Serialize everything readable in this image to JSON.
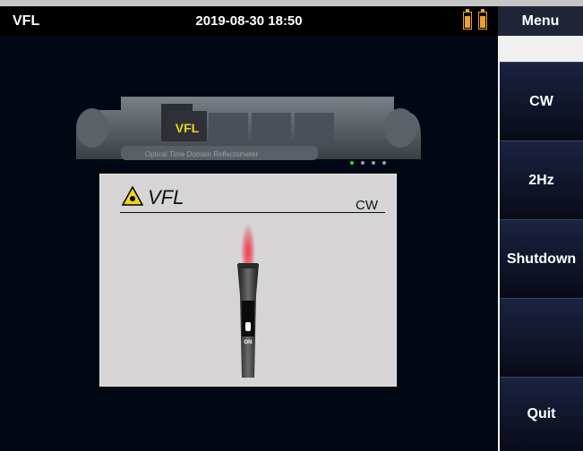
{
  "header": {
    "title": "VFL",
    "datetime": "2019-08-30 18:50",
    "battery_icons": [
      "battery-icon",
      "battery-icon"
    ],
    "colors": {
      "battery": "#e8a030",
      "background": "#020714"
    }
  },
  "sidebar": {
    "title": "Menu",
    "buttons": [
      {
        "label": "CW"
      },
      {
        "label": "2Hz"
      },
      {
        "label": "Shutdown"
      },
      {
        "label": ""
      },
      {
        "label": "Quit"
      }
    ]
  },
  "device": {
    "tab_label": "VFL",
    "caption": "Optical Time Domain Reflectometer"
  },
  "panel": {
    "title": "VFL",
    "mode": "CW",
    "torch_label": "ON",
    "colors": {
      "laser": "#e8001c",
      "warning": "#f2d21b"
    }
  }
}
